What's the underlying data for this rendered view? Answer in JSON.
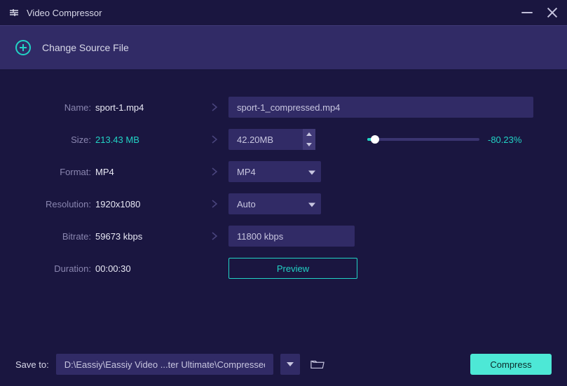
{
  "titlebar": {
    "title": "Video Compressor"
  },
  "sourcebar": {
    "label": "Change Source File"
  },
  "labels": {
    "name": "Name:",
    "size": "Size:",
    "format": "Format:",
    "resolution": "Resolution:",
    "bitrate": "Bitrate:",
    "duration": "Duration:"
  },
  "values": {
    "name": "sport-1.mp4",
    "size": "213.43 MB",
    "format": "MP4",
    "resolution": "1920x1080",
    "bitrate": "59673 kbps",
    "duration": "00:00:30"
  },
  "inputs": {
    "out_name": "sport-1_compressed.mp4",
    "out_size": "42.20MB",
    "out_format": "MP4",
    "out_resolution": "Auto",
    "out_bitrate": "11800 kbps"
  },
  "slider": {
    "percent_label": "-80.23%"
  },
  "buttons": {
    "preview": "Preview",
    "compress": "Compress"
  },
  "bottom": {
    "save_to_label": "Save to:",
    "save_path": "D:\\Eassiy\\Eassiy Video ...ter Ultimate\\Compressed"
  },
  "colors": {
    "accent": "#22d3c5"
  }
}
